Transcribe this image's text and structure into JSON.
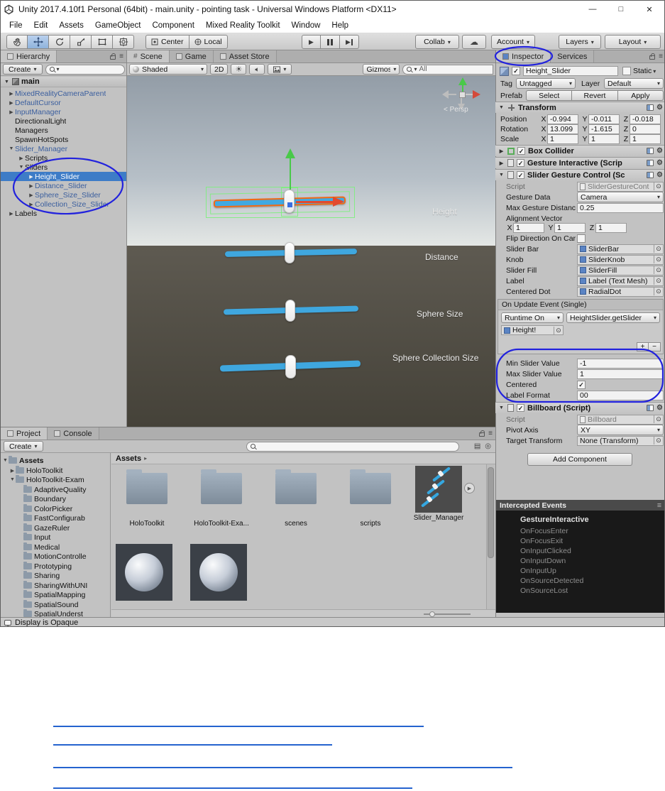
{
  "window": {
    "title": "Unity 2017.4.10f1 Personal (64bit) - main.unity - pointing task - Universal Windows Platform <DX11>"
  },
  "icons": {
    "expand": "▶",
    "collapse": "▼",
    "dropdown": "▾",
    "picker": "⊙",
    "check": "✓",
    "plus": "+",
    "minus": "−",
    "minimize": "—",
    "maximize": "□",
    "close": "✕",
    "menu": "≡",
    "play": "▶",
    "hash": "#",
    "cloud": "☁",
    "persp": "<",
    "crumb": "▸",
    "sun": "☀"
  },
  "colors": {
    "selection": "#3d7cc7",
    "prefab_text": "#3a5e9e",
    "slider_blue": "#3fa7df",
    "selected_outline_orange": "#f06a15",
    "annotation_blue": "#2222dd",
    "link_blue": "#2563cf"
  },
  "menu": {
    "items": [
      "File",
      "Edit",
      "Assets",
      "GameObject",
      "Component",
      "Mixed Reality Toolkit",
      "Window",
      "Help"
    ]
  },
  "toolbar": {
    "center": "Center",
    "local": "Local",
    "collab": "Collab",
    "account": "Account",
    "layers": "Layers",
    "layout": "Layout"
  },
  "hierarchy": {
    "tab": "Hierarchy",
    "create": "Create",
    "scene": "main",
    "items": [
      "MixedRealityCameraParent",
      "DefaultCursor",
      "InputManager",
      "DirectionalLight",
      "Managers",
      "SpawnHotSpots",
      "Slider_Manager",
      "Scripts",
      "Sliders",
      "Height_Slider",
      "Distance_Slider",
      "Sphere_Size_Slider",
      "Collection_Size_Slider",
      "Labels"
    ]
  },
  "scene": {
    "tab_scene": "Scene",
    "tab_game": "Game",
    "tab_asset_store": "Asset Store",
    "shaded": "Shaded",
    "mode_2d": "2D",
    "gizmos": "Gizmos",
    "search_filter": "All",
    "persp": "Persp",
    "labels": {
      "height": "Height",
      "distance": "Distance",
      "sphere_size": "Sphere Size",
      "sphere_collection_size": "Sphere Collection Size"
    }
  },
  "inspector": {
    "tab_inspector": "Inspector",
    "tab_services": "Services",
    "name": "Height_Slider",
    "static": "Static",
    "tag_label": "Tag",
    "tag": "Untagged",
    "layer_label": "Layer",
    "layer": "Default",
    "prefab_label": "Prefab",
    "select": "Select",
    "revert": "Revert",
    "apply": "Apply",
    "transform": {
      "title": "Transform",
      "position_label": "Position",
      "pos": {
        "x": "-0.994",
        "y": "-0.011",
        "z": "-0.018"
      },
      "rotation_label": "Rotation",
      "rot": {
        "x": "13.099",
        "y": "-1.615",
        "z": "0"
      },
      "scale_label": "Scale",
      "scl": {
        "x": "1",
        "y": "1",
        "z": "1"
      },
      "axis_x": "X",
      "axis_y": "Y",
      "axis_z": "Z"
    },
    "box_collider": "Box Collider",
    "gesture_interactive": "Gesture Interactive (Scrip",
    "slider_gesture": {
      "title": "Slider Gesture Control (Sc",
      "script_label": "Script",
      "script": "SliderGestureCont",
      "gesture_data_label": "Gesture Data",
      "gesture_data": "Camera",
      "max_gesture_label": "Max Gesture Distanc",
      "max_gesture": "0.25",
      "alignment_label": "Alignment Vector",
      "align": {
        "x": "1",
        "y": "1",
        "z": "1"
      },
      "flip_label": "Flip Direction On Car",
      "slider_bar_label": "Slider Bar",
      "slider_bar": "SliderBar",
      "knob_label": "Knob",
      "knob": "SliderKnob",
      "slider_fill_label": "Slider Fill",
      "slider_fill": "SliderFill",
      "label_label": "Label",
      "label": "Label (Text Mesh)",
      "centered_dot_label": "Centered Dot",
      "centered_dot": "RadialDot",
      "event_title": "On Update Event (Single)",
      "event_mode": "Runtime On",
      "event_function": "HeightSlider.getSlider",
      "event_target": "Height!",
      "min_label": "Min Slider Value",
      "min": "-1",
      "max_label": "Max Slider Value",
      "max": "1",
      "centered_label": "Centered",
      "format_label": "Label Format",
      "format": "00"
    },
    "billboard": {
      "title": "Billboard (Script)",
      "script_label": "Script",
      "script": "Billboard",
      "pivot_label": "Pivot Axis",
      "pivot": "XY",
      "target_label": "Target Transform",
      "target": "None (Transform)"
    },
    "add_component": "Add Component",
    "intercepted": {
      "title": "Intercepted Events",
      "heading": "GestureInteractive",
      "events": [
        "OnFocusEnter",
        "OnFocusExit",
        "OnInputClicked",
        "OnInputDown",
        "OnInputUp",
        "OnSourceDetected",
        "OnSourceLost"
      ]
    }
  },
  "project": {
    "tab_project": "Project",
    "tab_console": "Console",
    "create": "Create",
    "breadcrumb": "Assets",
    "tree": [
      "Assets",
      "HoloToolkit",
      "HoloToolkit-Exam",
      "AdaptiveQuality",
      "Boundary",
      "ColorPicker",
      "FastConfigurab",
      "GazeRuler",
      "Input",
      "Medical",
      "MotionControlle",
      "Prototyping",
      "Sharing",
      "SharingWithUNI",
      "SpatialMapping",
      "SpatialSound",
      "SpatialUnderst"
    ],
    "grid": [
      "HoloToolkit",
      "HoloToolkit-Exa...",
      "scenes",
      "scripts",
      "Slider_Manager"
    ]
  },
  "statusbar": {
    "text": "Display is Opaque"
  }
}
